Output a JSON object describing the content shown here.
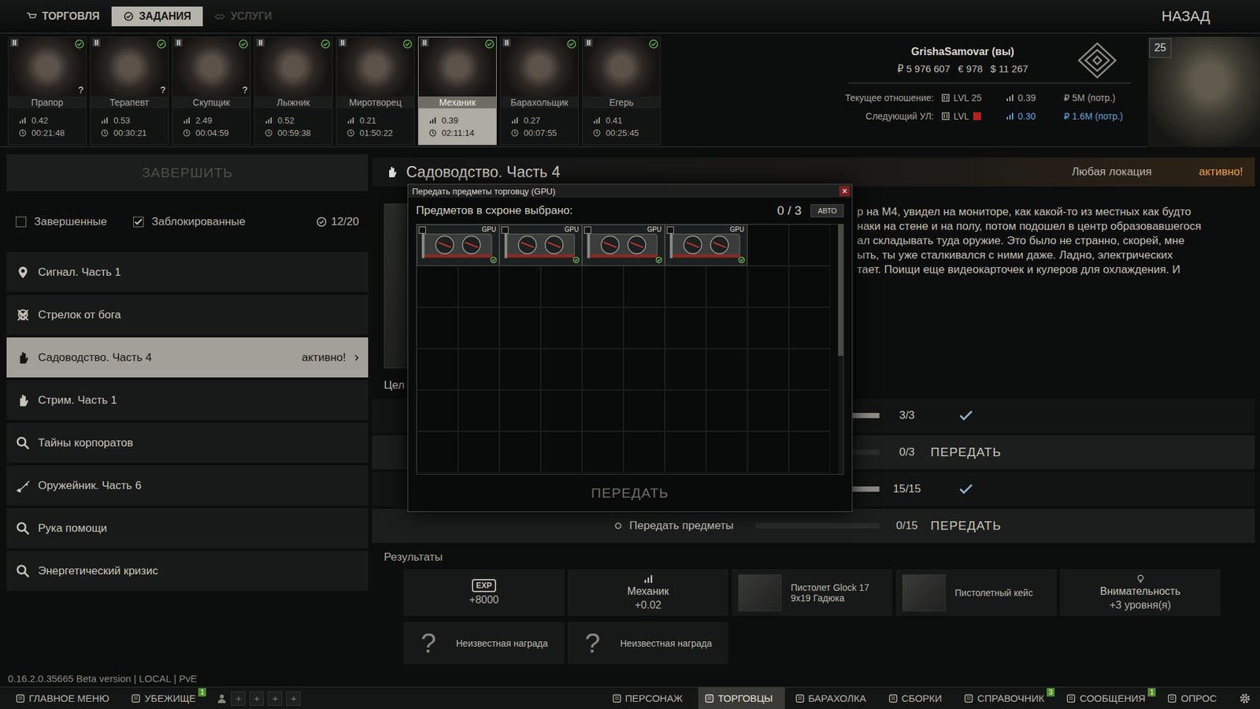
{
  "top_tabs": [
    {
      "label": "ТОРГОВЛЯ",
      "selected": false,
      "disabled": false
    },
    {
      "label": "ЗАДАНИЯ",
      "selected": true,
      "disabled": false
    },
    {
      "label": "УСЛУГИ",
      "selected": false,
      "disabled": true
    }
  ],
  "back_button": "НАЗАД",
  "traders": [
    {
      "name": "Прапор",
      "rank": "II",
      "unlocked": true,
      "mark": "?",
      "rating": "0.42",
      "timer": "00:21:48",
      "selected": false
    },
    {
      "name": "Терапевт",
      "rank": "II",
      "unlocked": true,
      "mark": "?",
      "rating": "0.53",
      "timer": "00:30:21",
      "selected": false
    },
    {
      "name": "Скупщик",
      "rank": "II",
      "unlocked": true,
      "mark": "?",
      "rating": "2.49",
      "timer": "00:04:59",
      "selected": false
    },
    {
      "name": "Лыжник",
      "rank": "II",
      "unlocked": true,
      "rating": "0.52",
      "timer": "00:59:38",
      "selected": false
    },
    {
      "name": "Миротворец",
      "rank": "II",
      "unlocked": true,
      "rating": "0.21",
      "timer": "01:50:22",
      "selected": false
    },
    {
      "name": "Механик",
      "rank": "II",
      "unlocked": true,
      "rating": "0.39",
      "timer": "02:11:14",
      "selected": true
    },
    {
      "name": "Барахольщик",
      "rank": "II",
      "unlocked": true,
      "rating": "0.27",
      "timer": "00:07:55",
      "selected": false
    },
    {
      "name": "Егерь",
      "rank": "II",
      "unlocked": true,
      "rating": "0.41",
      "timer": "00:25:45",
      "selected": false
    }
  ],
  "player": {
    "name": "GrishaSamovar (вы)",
    "money": [
      "₽ 5 976 607",
      "€ 978",
      "$ 11 267"
    ],
    "level": "25",
    "current": {
      "label": "Текущее отношение:",
      "level": "LVL 25",
      "rating": "0.39",
      "money": "₽ 5M (потр.)"
    },
    "next": {
      "label": "Следующий УЛ:",
      "level": "LVL",
      "level_met": false,
      "rating": "0.30",
      "rating_met": true,
      "money": "₽ 1.6M (потр.)",
      "money_met": true
    }
  },
  "sidebar": {
    "complete_button": {
      "label": "ЗАВЕРШИТЬ",
      "disabled": true
    },
    "filters": [
      {
        "label": "Завершенные",
        "checked": false
      },
      {
        "label": "Заблокированные",
        "checked": true
      }
    ],
    "counter": "12/20",
    "quests": [
      {
        "title": "Сигнал. Часть 1",
        "kind": "location",
        "selected": false
      },
      {
        "title": "Стрелок от бога",
        "kind": "elimination",
        "selected": false
      },
      {
        "title": "Садоводство. Часть 4",
        "kind": "handover",
        "status": "активно!",
        "selected": true
      },
      {
        "title": "Стрим. Часть 1",
        "kind": "handover",
        "selected": false
      },
      {
        "title": "Тайны корпоратов",
        "kind": "search",
        "selected": false
      },
      {
        "title": "Оружейник. Часть 6",
        "kind": "weapon",
        "selected": false
      },
      {
        "title": "Рука помощи",
        "kind": "search",
        "selected": false
      },
      {
        "title": "Энергетический кризис",
        "kind": "search",
        "selected": false
      }
    ]
  },
  "quest": {
    "title": "Садоводство. Часть 4",
    "kind": "handover",
    "location": "Любая локация",
    "status": "активно!",
    "description": [
      "р на М4, увидел на мониторе, как какой-то из местных как будто",
      "наки на стене и на полу, потом подошел в центр образовавшегося",
      "ал складывать туда оружие. Это было не странно, скорей, мне",
      "ыть, ты уже сталкивался с ними даже. Ладно, электрических",
      "тает. Поищи еще видеокарточек и кулеров для охлаждения. И"
    ],
    "objectives_label": "Цел",
    "objectives": [
      {
        "progress": "3/3",
        "level": 1,
        "done": true
      },
      {
        "progress": "0/3",
        "level": 0,
        "done": false,
        "action": "ПЕРЕДАТЬ"
      },
      {
        "progress": "15/15",
        "level": 1,
        "done": true
      },
      {
        "text": "Передать предметы",
        "progress": "0/15",
        "level": 0,
        "done": false,
        "action": "ПЕРЕДАТЬ"
      }
    ]
  },
  "results": {
    "label": "Результаты",
    "rewards": [
      {
        "kind": "exp",
        "badge": "EXP",
        "value": "+8000"
      },
      {
        "kind": "standing",
        "name": "Механик",
        "value": "+0.02"
      },
      {
        "kind": "item",
        "name": "Пистолет Glock 17 9x19 Гадюка"
      },
      {
        "kind": "item",
        "name": "Пистолетный кейс"
      },
      {
        "kind": "skill",
        "name": "Внимательность",
        "value": "+3 уровня(я)"
      },
      {
        "kind": "unknown",
        "glyph": "?",
        "name": "Неизвестная награда"
      },
      {
        "kind": "unknown",
        "glyph": "?",
        "name": "Неизвестная награда"
      }
    ]
  },
  "modal": {
    "title": "Передать предметы торговцу (GPU)",
    "close": "×",
    "selected_label": "Предметов в схроне выбрано:",
    "selected_count": "0 / 3",
    "auto_button": "АВТО",
    "items": [
      {
        "label": "GPU",
        "selected": false,
        "found_in_raid": true
      },
      {
        "label": "GPU",
        "selected": false,
        "found_in_raid": true
      },
      {
        "label": "GPU",
        "selected": false,
        "found_in_raid": true
      },
      {
        "label": "GPU",
        "selected": false,
        "found_in_raid": true
      }
    ],
    "submit": {
      "label": "ПЕРЕДАТЬ",
      "disabled": true
    }
  },
  "footer": {
    "version": "0.16.2.0.35665 Beta version | LOCAL | PvE",
    "nav_left": [
      {
        "label": "ГЛАВНОЕ МЕНЮ",
        "selected": false
      },
      {
        "label": "УБЕЖИЩЕ",
        "badge": "1",
        "selected": false
      }
    ],
    "party_slots": [
      "+",
      "+",
      "+",
      "+"
    ],
    "nav_right": [
      {
        "label": "ПЕРСОНАЖ",
        "selected": false
      },
      {
        "label": "ТОРГОВЦЫ",
        "selected": true
      },
      {
        "label": "БАРАХОЛКА",
        "selected": false
      },
      {
        "label": "СБОРКИ",
        "selected": false
      },
      {
        "label": "СПРАВОЧНИК",
        "badge": "3",
        "selected": false
      },
      {
        "label": "СООБЩЕНИЯ",
        "badge": "1",
        "selected": false
      },
      {
        "label": "ОПРОС",
        "selected": false
      }
    ]
  }
}
